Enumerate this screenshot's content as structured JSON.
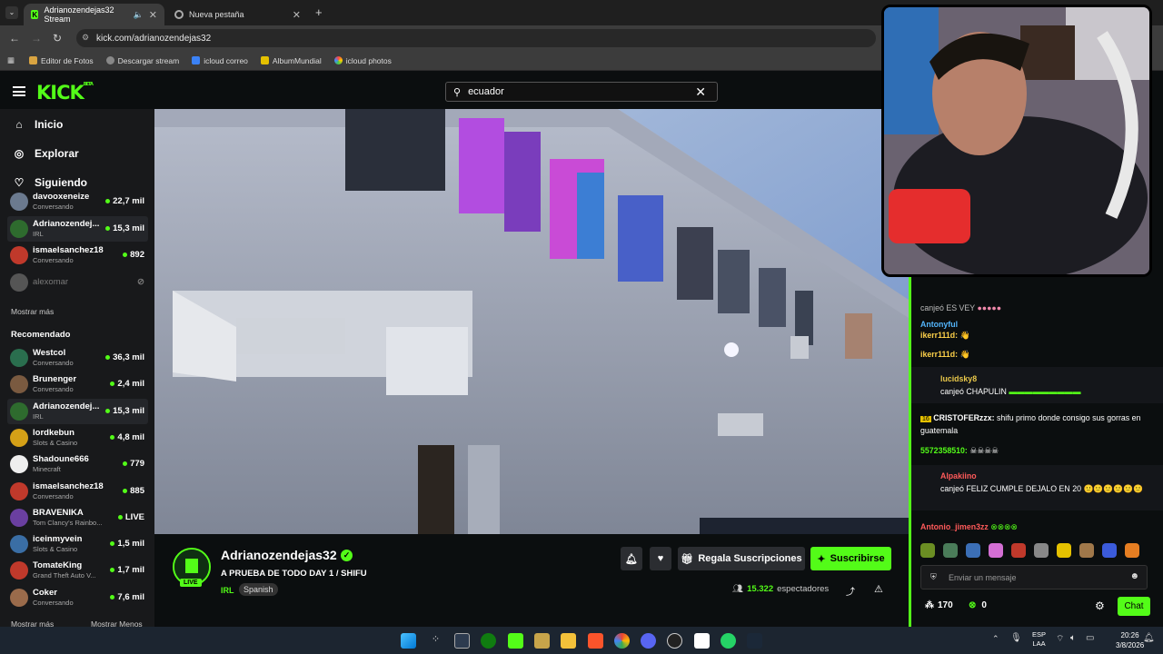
{
  "browser": {
    "tabs": [
      {
        "label": "Adrianozendejas32 Stream"
      },
      {
        "label": "Nueva pestaña"
      }
    ],
    "url": "kick.com/adrianozendejas32",
    "bookmarks": [
      "Editor de Fotos",
      "Descargar stream",
      "icloud correo",
      "AlbumMundial",
      "icloud photos"
    ]
  },
  "kick": {
    "logo": "KICK",
    "logo_sup": "BETA",
    "search_value": "ecuador",
    "nav": {
      "home": "Inicio",
      "explore": "Explorar",
      "following": "Siguiendo"
    },
    "following": [
      {
        "name": "davooxeneize",
        "sub": "Conversando",
        "viewers": "22,7 mil",
        "color": "#6b7a8f"
      },
      {
        "name": "Adrianozendej...",
        "sub": "IRL",
        "viewers": "15,3 mil",
        "color": "#2e6b2e"
      },
      {
        "name": "ismaelsanchez18",
        "sub": "Conversando",
        "viewers": "892",
        "color": "#c0392b"
      },
      {
        "name": "alexomar",
        "sub": "",
        "viewers": "",
        "color": "#555"
      }
    ],
    "show_more": "Mostrar más",
    "recommended_title": "Recomendado",
    "recommended": [
      {
        "name": "Westcol",
        "sub": "Conversando",
        "viewers": "36,3 mil",
        "color": "#2a6e4e"
      },
      {
        "name": "Brunenger",
        "sub": "Conversando",
        "viewers": "2,4 mil",
        "color": "#7a5a40"
      },
      {
        "name": "Adrianozendej...",
        "sub": "IRL",
        "viewers": "15,3 mil",
        "color": "#2e6b2e"
      },
      {
        "name": "lordkebun",
        "sub": "Slots & Casino",
        "viewers": "4,8 mil",
        "color": "#d4a017"
      },
      {
        "name": "Shadoune666",
        "sub": "Minecraft",
        "viewers": "779",
        "color": "#eee"
      },
      {
        "name": "ismaelsanchez18",
        "sub": "Conversando",
        "viewers": "885",
        "color": "#c0392b"
      },
      {
        "name": "BRAVENIKA",
        "sub": "Tom Clancy's Rainbo...",
        "viewers": "LIVE",
        "color": "#6a3fa0"
      },
      {
        "name": "iceinmyvein",
        "sub": "Slots & Casino",
        "viewers": "1,5 mil",
        "color": "#3a6ea5"
      },
      {
        "name": "TomateKing",
        "sub": "Grand Theft Auto V...",
        "viewers": "1,7 mil",
        "color": "#c0392b"
      },
      {
        "name": "Coker",
        "sub": "Conversando",
        "viewers": "7,6 mil",
        "color": "#9a6b4b"
      }
    ],
    "footer_more": "Mostrar más",
    "footer_less": "Mostrar Menos"
  },
  "stream": {
    "channel": "Adrianozendejas32",
    "live": "LIVE",
    "title": "A PRUEBA DE TODO DAY 1 / SHIFU",
    "category": "IRL",
    "language": "Spanish",
    "gift_subs": "Regala Suscripciones",
    "subscribe": "Suscribirse",
    "viewers": "15.322",
    "viewers_label": "espectadores"
  },
  "chat": {
    "messages": [
      {
        "user": "kerr111d:",
        "text": ""
      },
      {
        "user": "Antonyful",
        "text": ""
      },
      {
        "user": "ikerr111d:",
        "text": ""
      },
      {
        "user": "ikerr111d:",
        "text": ""
      },
      {
        "user": "lucidsky8",
        "text": "canjeó CHAPULIN"
      },
      {
        "user": "CRISTOFERzzx:",
        "text": "shifu primo donde consigo sus gorras en guatemala"
      },
      {
        "user": "5572358510:",
        "text": ""
      },
      {
        "user": "Alpakiino",
        "text": "canjeó FELIZ CUMPLE DEJALO EN 20"
      },
      {
        "user": "Antonio_jimen3zz",
        "text": ""
      }
    ],
    "top_partial": "canjeó ES  VEY",
    "input_placeholder": "Enviar un mensaje",
    "points": "170",
    "kicks": "0",
    "chat_button": "Chat"
  },
  "taskbar": {
    "lang_top": "ESP",
    "lang_bottom": "LAA",
    "time": "20:26",
    "date": "3/8/2026"
  },
  "colors": {
    "accent": "#53fc18",
    "bg": "#0b0e0f",
    "sidebar": "#18191b"
  }
}
